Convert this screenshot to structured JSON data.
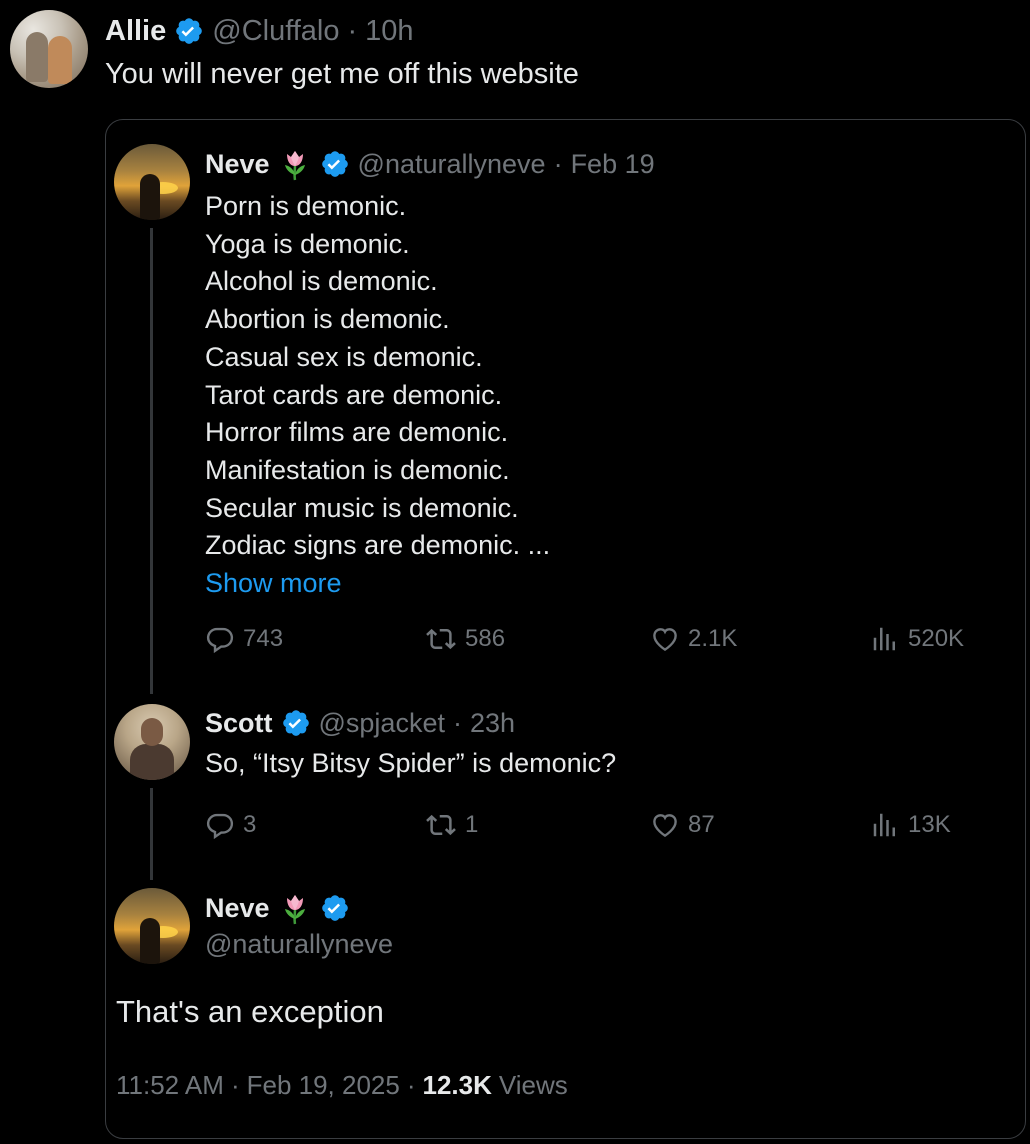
{
  "main_tweet": {
    "name": "Allie",
    "handle": "@Cluffalo",
    "sep": "·",
    "time": "10h",
    "text": "You will never get me off this website"
  },
  "quote": {
    "tweet1": {
      "name": "Neve",
      "handle": "@naturallyneve",
      "sep": "·",
      "time": "Feb 19",
      "lines": [
        "Porn is demonic.",
        "Yoga is demonic.",
        "Alcohol is demonic.",
        "Abortion is demonic.",
        "Casual sex is demonic.",
        "Tarot cards are demonic.",
        "Horror films are demonic.",
        "Manifestation is demonic.",
        "Secular music is demonic.",
        "Zodiac signs are demonic. ..."
      ],
      "show_more": "Show more",
      "replies": "743",
      "reposts": "586",
      "likes": "2.1K",
      "views": "520K"
    },
    "tweet2": {
      "name": "Scott",
      "handle": "@spjacket",
      "sep": "·",
      "time": "23h",
      "text": "So, “Itsy Bitsy Spider” is demonic?",
      "replies": "3",
      "reposts": "1",
      "likes": "87",
      "views": "13K"
    },
    "tweet3": {
      "name": "Neve",
      "handle": "@naturallyneve",
      "text": "That's an exception",
      "time": "11:52 AM",
      "sep1": "·",
      "date": "Feb 19, 2025",
      "sep2": "·",
      "views_count": "12.3K",
      "views_label": "Views"
    }
  },
  "colors": {
    "background": "#000000",
    "text": "#e7e9ea",
    "muted": "#71767b",
    "link": "#1d9bf0",
    "verified": "#1d9bf0",
    "border": "#3a3d41"
  },
  "icons": {
    "verified": "verified-badge-icon",
    "tulip": "tulip-emoji-icon",
    "reply": "reply-icon",
    "repost": "repost-icon",
    "like": "heart-icon",
    "views": "views-chart-icon"
  }
}
